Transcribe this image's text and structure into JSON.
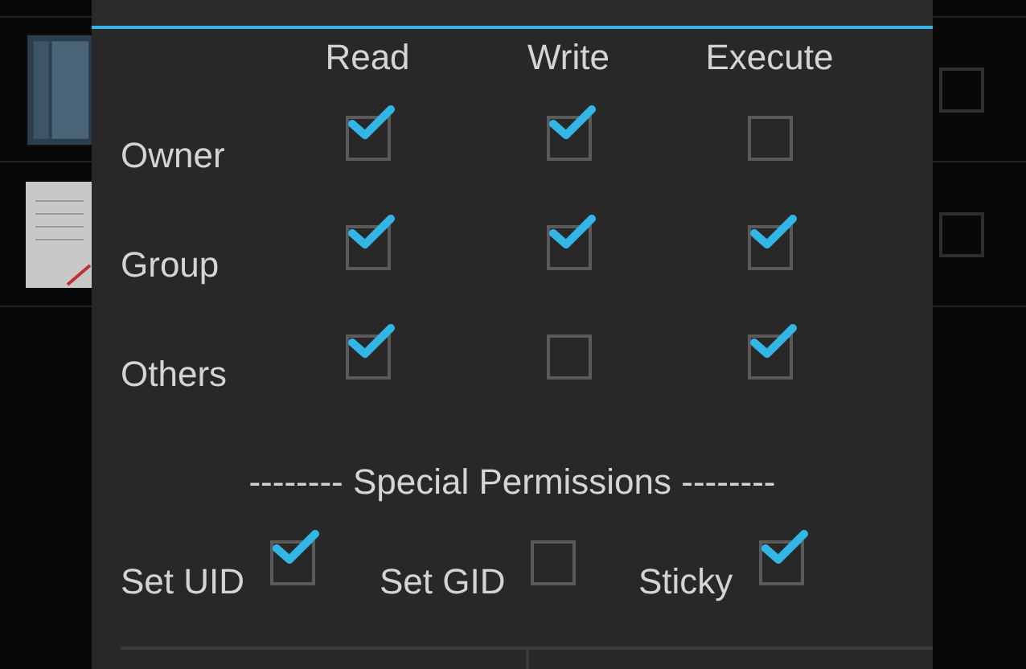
{
  "background_items": [
    {
      "kind": "folder",
      "checked": false
    },
    {
      "kind": "file",
      "checked": false
    }
  ],
  "dialog": {
    "columns": [
      "Read",
      "Write",
      "Execute"
    ],
    "rows": [
      {
        "label": "Owner",
        "permissions": [
          {
            "checked": true
          },
          {
            "checked": true
          },
          {
            "checked": false
          }
        ]
      },
      {
        "label": "Group",
        "permissions": [
          {
            "checked": true
          },
          {
            "checked": true
          },
          {
            "checked": true
          }
        ]
      },
      {
        "label": "Others",
        "permissions": [
          {
            "checked": true
          },
          {
            "checked": false
          },
          {
            "checked": true
          }
        ]
      }
    ],
    "special_heading": "-------- Special Permissions --------",
    "special": [
      {
        "label": "Set UID",
        "checked": true
      },
      {
        "label": "Set GID",
        "checked": false
      },
      {
        "label": "Sticky",
        "checked": true
      }
    ]
  }
}
